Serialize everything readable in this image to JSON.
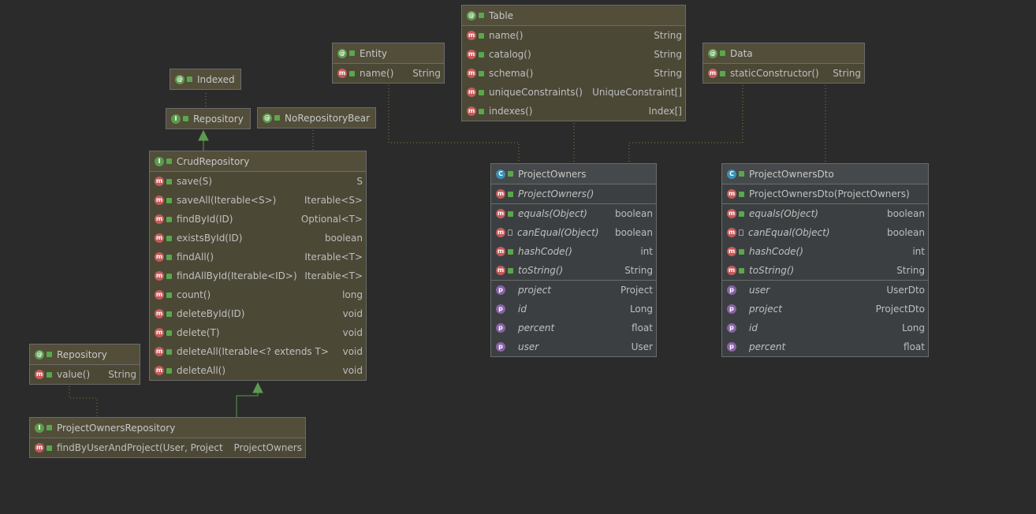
{
  "diagram": {
    "nodes": [
      {
        "id": "indexed",
        "kind": "ann",
        "icon": "at-icon",
        "title": "Indexed",
        "members": []
      },
      {
        "id": "repository",
        "kind": "iface",
        "icon": "interface-icon",
        "title": "Repository",
        "members": []
      },
      {
        "id": "norepobean",
        "kind": "ann",
        "icon": "at-icon",
        "title": "NoRepositoryBear",
        "members": []
      },
      {
        "id": "entity",
        "kind": "ann",
        "icon": "at-icon",
        "title": "Entity",
        "sections": [
          [
            {
              "name": "name()",
              "type": "String",
              "icon": "method-icon"
            }
          ]
        ]
      },
      {
        "id": "table",
        "kind": "ann",
        "icon": "at-icon",
        "title": "Table",
        "sections": [
          [
            {
              "name": "name()",
              "type": "String",
              "icon": "method-icon"
            },
            {
              "name": "catalog()",
              "type": "String",
              "icon": "method-icon"
            },
            {
              "name": "schema()",
              "type": "String",
              "icon": "method-icon"
            },
            {
              "name": "uniqueConstraints()",
              "type": "UniqueConstraint[]",
              "icon": "method-icon"
            },
            {
              "name": "indexes()",
              "type": "Index[]",
              "icon": "method-icon"
            }
          ]
        ]
      },
      {
        "id": "data",
        "kind": "ann",
        "icon": "at-icon",
        "title": "Data",
        "sections": [
          [
            {
              "name": "staticConstructor()",
              "type": "String",
              "icon": "method-icon"
            }
          ]
        ]
      },
      {
        "id": "crud",
        "kind": "iface",
        "icon": "interface-icon",
        "title": "CrudRepository",
        "sections": [
          [
            {
              "name": "save(S)",
              "type": "S",
              "icon": "method-icon"
            },
            {
              "name": "saveAll(Iterable<S>)",
              "type": "Iterable<S>",
              "icon": "method-icon"
            },
            {
              "name": "findById(ID)",
              "type": "Optional<T>",
              "icon": "method-icon"
            },
            {
              "name": "existsById(ID)",
              "type": "boolean",
              "icon": "method-icon"
            },
            {
              "name": "findAll()",
              "type": "Iterable<T>",
              "icon": "method-icon"
            },
            {
              "name": "findAllById(Iterable<ID>)",
              "type": "Iterable<T>",
              "icon": "method-icon"
            },
            {
              "name": "count()",
              "type": "long",
              "icon": "method-icon"
            },
            {
              "name": "deleteById(ID)",
              "type": "void",
              "icon": "method-icon"
            },
            {
              "name": "delete(T)",
              "type": "void",
              "icon": "method-icon"
            },
            {
              "name": "deleteAll(Iterable<? extends T>",
              "type": "void",
              "icon": "method-icon"
            },
            {
              "name": "deleteAll()",
              "type": "void",
              "icon": "method-icon"
            }
          ]
        ]
      },
      {
        "id": "repoann",
        "kind": "ann",
        "icon": "at-icon",
        "title": "Repository",
        "sections": [
          [
            {
              "name": "value()",
              "type": "String",
              "icon": "method-icon"
            }
          ]
        ]
      },
      {
        "id": "por",
        "kind": "iface",
        "icon": "interface-icon",
        "title": "ProjectOwnersRepository",
        "sections": [
          [
            {
              "name": "findByUserAndProject(User, Project",
              "type": "ProjectOwners",
              "icon": "method-icon"
            }
          ]
        ]
      },
      {
        "id": "po",
        "kind": "cls",
        "icon": "class-icon",
        "title": "ProjectOwners",
        "sections": [
          [
            {
              "name": "ProjectOwners()",
              "type": "",
              "icon": "constructor-icon",
              "italic": true
            }
          ],
          [
            {
              "name": "equals(Object)",
              "type": "boolean",
              "icon": "method-icon",
              "italic": true
            },
            {
              "name": "canEqual(Object)",
              "type": "boolean",
              "icon": "method-icon",
              "italic": true,
              "vis": "lock"
            },
            {
              "name": "hashCode()",
              "type": "int",
              "icon": "method-icon",
              "italic": true
            },
            {
              "name": "toString()",
              "type": "String",
              "icon": "method-icon",
              "italic": true
            }
          ],
          [
            {
              "name": "project",
              "type": "Project",
              "icon": "property-icon",
              "italic": true,
              "vis": "none"
            },
            {
              "name": "id",
              "type": "Long",
              "icon": "property-icon",
              "italic": true,
              "vis": "none"
            },
            {
              "name": "percent",
              "type": "float",
              "icon": "property-icon",
              "italic": true,
              "vis": "none"
            },
            {
              "name": "user",
              "type": "User",
              "icon": "property-icon",
              "italic": true,
              "vis": "none"
            }
          ]
        ]
      },
      {
        "id": "podto",
        "kind": "cls",
        "icon": "class-icon",
        "title": "ProjectOwnersDto",
        "sections": [
          [
            {
              "name": "ProjectOwnersDto(ProjectOwners)",
              "type": "",
              "icon": "constructor-icon"
            }
          ],
          [
            {
              "name": "equals(Object)",
              "type": "boolean",
              "icon": "method-icon",
              "italic": true
            },
            {
              "name": "canEqual(Object)",
              "type": "boolean",
              "icon": "method-icon",
              "italic": true,
              "vis": "lock"
            },
            {
              "name": "hashCode()",
              "type": "int",
              "icon": "method-icon",
              "italic": true
            },
            {
              "name": "toString()",
              "type": "String",
              "icon": "method-icon",
              "italic": true
            }
          ],
          [
            {
              "name": "user",
              "type": "UserDto",
              "icon": "property-icon",
              "italic": true,
              "vis": "none"
            },
            {
              "name": "project",
              "type": "ProjectDto",
              "icon": "property-icon",
              "italic": true,
              "vis": "none"
            },
            {
              "name": "id",
              "type": "Long",
              "icon": "property-icon",
              "italic": true,
              "vis": "none"
            },
            {
              "name": "percent",
              "type": "float",
              "icon": "property-icon",
              "italic": true,
              "vis": "none"
            }
          ]
        ]
      }
    ]
  },
  "colors": {
    "background": "#2b2b2b",
    "annotation": "#4b4836",
    "class": "#3c3f41",
    "inherit_arrow": "#5c9b4e",
    "dotted_link": "#6a8a3a"
  }
}
